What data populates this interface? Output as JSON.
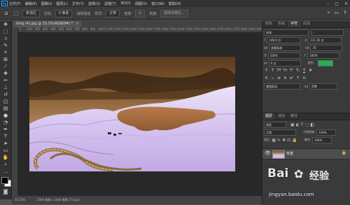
{
  "menubar": {
    "logo": "Ps",
    "items": [
      "文件(F)",
      "编辑(E)",
      "图像(I)",
      "图层(L)",
      "文字(Y)",
      "选择(S)",
      "滤镜(T)",
      "3D(D)",
      "视图(V)",
      "窗口(W)",
      "帮助(H)"
    ],
    "controls": [
      "–",
      "▢",
      "✕"
    ]
  },
  "options": {
    "mode": "新选区",
    "feather_label": "羽化:",
    "feather_value": "0 像素",
    "antialias": "消除锯齿",
    "style_label": "样式:",
    "style_value": "正常",
    "width_label": "宽度:",
    "height_label": "高度:",
    "select_mask": "选择并遮住..."
  },
  "document": {
    "tab_title": "timg (4).jpg @ 33.3%(RGB/8#) *",
    "ruler_ticks": [
      "0",
      "100",
      "200",
      "300",
      "400",
      "500",
      "600",
      "700",
      "800",
      "900",
      "1000",
      "1100",
      "1200",
      "1300",
      "1400",
      "1500",
      "1600",
      "1700",
      "1800",
      "1900",
      "2000",
      "2100",
      "2200",
      "2300",
      "2400",
      "2500",
      "2600",
      "2700",
      "2800",
      "2900",
      "3000"
    ]
  },
  "status": {
    "zoom": "33.33%",
    "info": "2560 像素 x 1440 像素 (72 ppi)"
  },
  "panels": {
    "top_tabs": [
      "颜色",
      "色板",
      "字符",
      "段落"
    ],
    "char_font": "宋体",
    "char_style": "-",
    "size_value": "148.6 点",
    "leading_value": "111.26 点",
    "kerning_value": "度量标准",
    "tracking_value": "70",
    "vscale_value": "100%",
    "hscale_value": "100%",
    "baseline_value": "0 点",
    "color_label": "颜色:",
    "lang_value": "美国英语",
    "aa_label": "aa",
    "aa_value": "浑厚",
    "layers_tabs": [
      "图层",
      "通道",
      "路径"
    ],
    "kind_label": "类型",
    "blend_value": "正常",
    "opacity_label": "不透明度:",
    "opacity_value": "100%",
    "lock_label": "锁定:",
    "fill_label": "填充:",
    "fill_value": "100%",
    "layer_name": "背景"
  },
  "watermark": {
    "logo_text": "Bai",
    "brand_cn": "经验",
    "url": "jingyan.baidu.com"
  },
  "colors": {
    "text_color_chip": "#22b14c"
  }
}
